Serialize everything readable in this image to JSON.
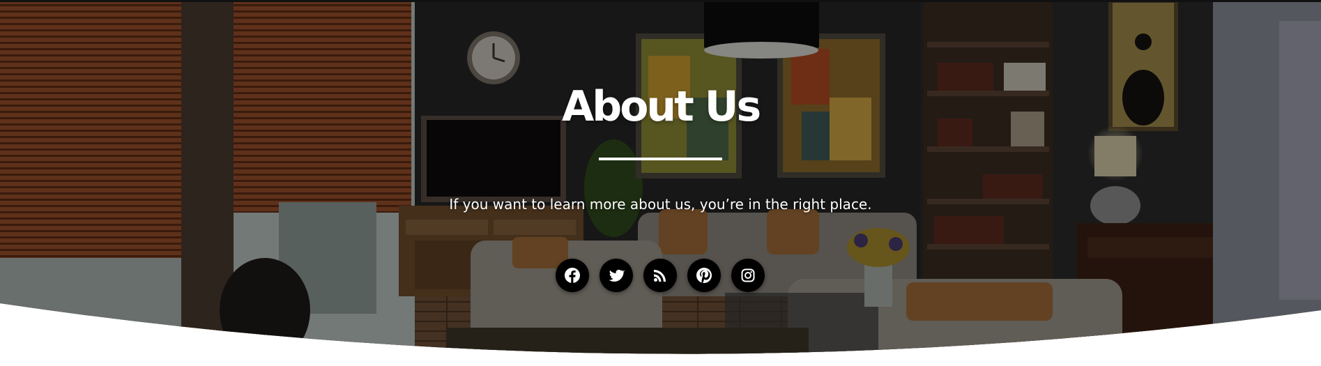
{
  "hero": {
    "title": "About Us",
    "subtitle": "If you want to learn more about us, you’re in the right place."
  },
  "social": [
    {
      "icon": "facebook-icon"
    },
    {
      "icon": "twitter-icon"
    },
    {
      "icon": "rss-icon"
    },
    {
      "icon": "pinterest-icon"
    },
    {
      "icon": "instagram-icon"
    }
  ],
  "colors": {
    "overlay": "#000000",
    "text": "#ffffff",
    "social_bg": "#000000",
    "page_bg": "#ffffff"
  }
}
